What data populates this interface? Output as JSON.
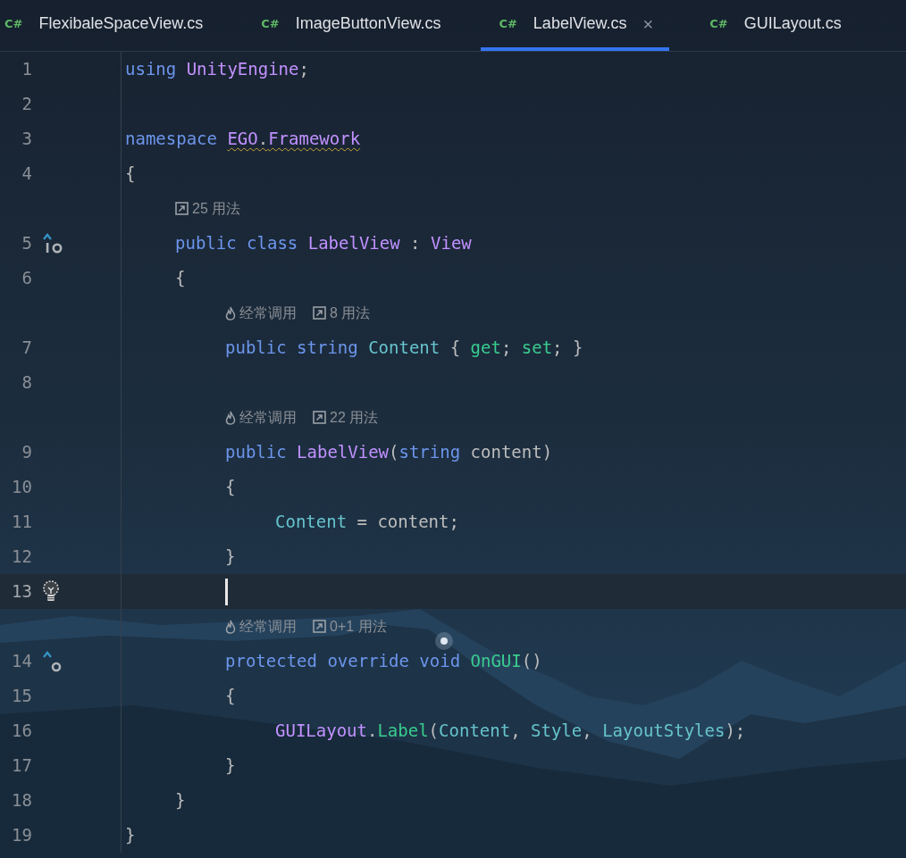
{
  "tabs": [
    {
      "icon": "C#",
      "label": "FlexibaleSpaceView.cs",
      "selected": false,
      "closable": false
    },
    {
      "icon": "C#",
      "label": "ImageButtonView.cs",
      "selected": false,
      "closable": false
    },
    {
      "icon": "C#",
      "label": "LabelView.cs",
      "selected": true,
      "closable": true,
      "close_glyph": "×"
    },
    {
      "icon": "C#",
      "label": "GUILayout.cs",
      "selected": false,
      "closable": false
    }
  ],
  "rows": [
    {
      "kind": "code",
      "number": "1",
      "current": false,
      "tokens": [
        {
          "t": "using ",
          "kind": "kw"
        },
        {
          "t": "UnityEngine",
          "kind": "type"
        },
        {
          "t": ";",
          "kind": "plain"
        }
      ]
    },
    {
      "kind": "code",
      "number": "2",
      "current": false,
      "tokens": []
    },
    {
      "kind": "code",
      "number": "3",
      "current": false,
      "tokens": [
        {
          "t": "namespace ",
          "kind": "kw",
          "warning": false
        },
        {
          "t": "EGO",
          "kind": "type",
          "warning": true
        },
        {
          "t": ".",
          "kind": "plain",
          "warning": true
        },
        {
          "t": "Framework",
          "kind": "type",
          "warning": true
        }
      ]
    },
    {
      "kind": "code",
      "number": "4",
      "current": false,
      "tokens": [
        {
          "t": "{",
          "kind": "plain"
        }
      ]
    },
    {
      "kind": "hint",
      "lead": "\t",
      "items": [
        {
          "kind": "usages",
          "text": "25 用法"
        }
      ]
    },
    {
      "kind": "code",
      "number": "5",
      "current": false,
      "gutter": {
        "kind": "implemented"
      },
      "tokens": [
        {
          "t": "\tpublic class ",
          "kind": "kw"
        },
        {
          "t": "LabelView",
          "kind": "type"
        },
        {
          "t": " : ",
          "kind": "plain"
        },
        {
          "t": "View",
          "kind": "type"
        }
      ]
    },
    {
      "kind": "code",
      "number": "6",
      "current": false,
      "tokens": [
        {
          "t": "\t{",
          "kind": "plain"
        }
      ]
    },
    {
      "kind": "hint",
      "lead": "\t\t",
      "items": [
        {
          "kind": "hot",
          "text": "经常调用"
        },
        {
          "kind": "usages",
          "text": "8 用法"
        }
      ]
    },
    {
      "kind": "code",
      "number": "7",
      "current": false,
      "tokens": [
        {
          "t": "\t\tpublic string ",
          "kind": "kw"
        },
        {
          "t": "Content",
          "kind": "prop"
        },
        {
          "t": " { ",
          "kind": "plain"
        },
        {
          "t": "get",
          "kind": "method"
        },
        {
          "t": "; ",
          "kind": "plain"
        },
        {
          "t": "set",
          "kind": "method"
        },
        {
          "t": "; }",
          "kind": "plain"
        }
      ]
    },
    {
      "kind": "code",
      "number": "8",
      "current": false,
      "tokens": []
    },
    {
      "kind": "hint",
      "lead": "\t\t",
      "items": [
        {
          "kind": "hot",
          "text": "经常调用"
        },
        {
          "kind": "usages",
          "text": "22 用法"
        }
      ]
    },
    {
      "kind": "code",
      "number": "9",
      "current": false,
      "tokens": [
        {
          "t": "\t\tpublic ",
          "kind": "kw"
        },
        {
          "t": "LabelView",
          "kind": "type"
        },
        {
          "t": "(",
          "kind": "plain"
        },
        {
          "t": "string",
          "kind": "kw"
        },
        {
          "t": " content)",
          "kind": "plain"
        }
      ]
    },
    {
      "kind": "code",
      "number": "10",
      "current": false,
      "tokens": [
        {
          "t": "\t\t{",
          "kind": "plain"
        }
      ]
    },
    {
      "kind": "code",
      "number": "11",
      "current": false,
      "tokens": [
        {
          "t": "\t\t\tContent",
          "kind": "prop"
        },
        {
          "t": " = content;",
          "kind": "plain"
        }
      ]
    },
    {
      "kind": "code",
      "number": "12",
      "current": false,
      "tokens": [
        {
          "t": "\t\t}",
          "kind": "plain"
        }
      ]
    },
    {
      "kind": "code",
      "number": "13",
      "current": true,
      "gutter": {
        "kind": "bulb"
      },
      "tokens": []
    },
    {
      "kind": "hint",
      "lead": "\t\t",
      "items": [
        {
          "kind": "hot",
          "text": "经常调用"
        },
        {
          "kind": "usages",
          "text": "0+1 用法"
        }
      ]
    },
    {
      "kind": "code",
      "number": "14",
      "current": false,
      "gutter": {
        "kind": "override"
      },
      "tokens": [
        {
          "t": "\t\tprotected override void ",
          "kind": "kw"
        },
        {
          "t": "OnGUI",
          "kind": "method"
        },
        {
          "t": "()",
          "kind": "plain"
        }
      ]
    },
    {
      "kind": "code",
      "number": "15",
      "current": false,
      "tokens": [
        {
          "t": "\t\t{",
          "kind": "plain"
        }
      ]
    },
    {
      "kind": "code",
      "number": "16",
      "current": false,
      "tokens": [
        {
          "t": "\t\t\tGUILayout",
          "kind": "type"
        },
        {
          "t": ".",
          "kind": "plain"
        },
        {
          "t": "Label",
          "kind": "method"
        },
        {
          "t": "(",
          "kind": "plain"
        },
        {
          "t": "Content",
          "kind": "prop"
        },
        {
          "t": ", ",
          "kind": "plain"
        },
        {
          "t": "Style",
          "kind": "prop"
        },
        {
          "t": ", ",
          "kind": "plain"
        },
        {
          "t": "LayoutStyles",
          "kind": "prop"
        },
        {
          "t": ");",
          "kind": "plain"
        }
      ]
    },
    {
      "kind": "code",
      "number": "17",
      "current": false,
      "tokens": [
        {
          "t": "\t\t}",
          "kind": "plain"
        }
      ]
    },
    {
      "kind": "code",
      "number": "18",
      "current": false,
      "tokens": [
        {
          "t": "\t}",
          "kind": "plain"
        }
      ]
    },
    {
      "kind": "code",
      "number": "19",
      "current": false,
      "tokens": [
        {
          "t": "}",
          "kind": "plain"
        }
      ]
    }
  ]
}
